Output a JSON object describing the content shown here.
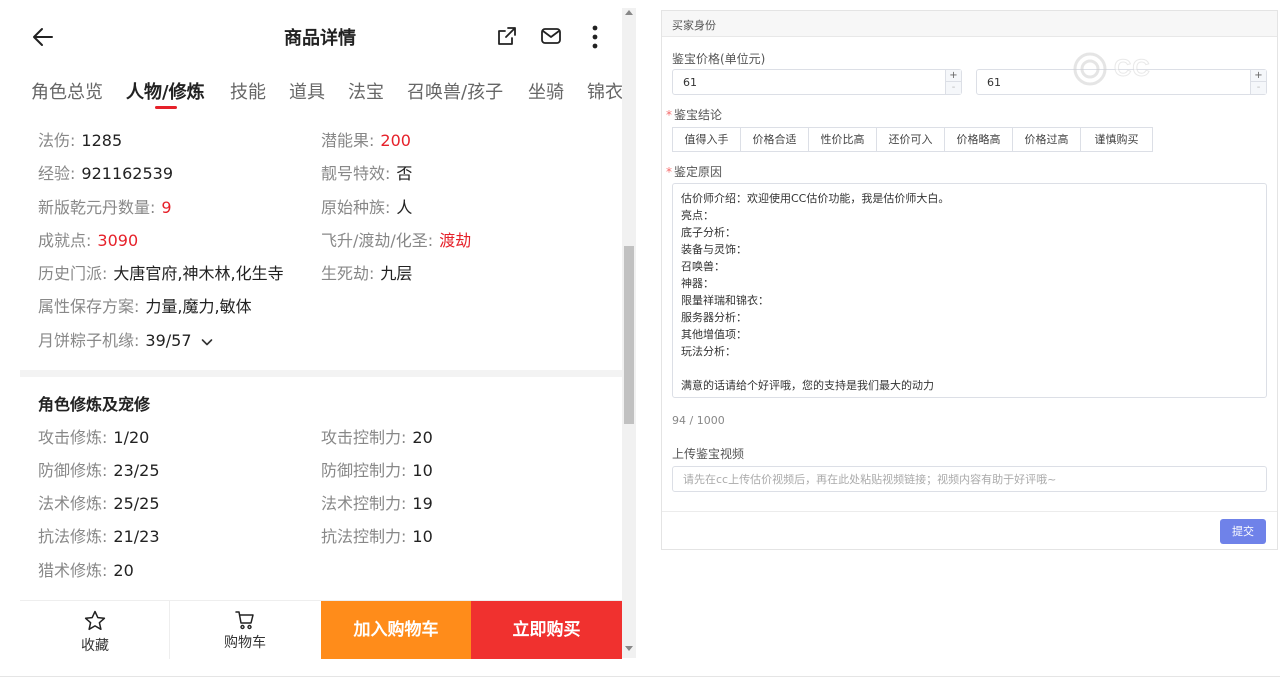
{
  "header": {
    "title": "商品详情"
  },
  "tabs": [
    {
      "label": "角色总览"
    },
    {
      "label": "人物/修炼"
    },
    {
      "label": "技能"
    },
    {
      "label": "道具"
    },
    {
      "label": "法宝"
    },
    {
      "label": "召唤兽/孩子"
    },
    {
      "label": "坐骑"
    },
    {
      "label": "锦衣"
    }
  ],
  "attributes": {
    "fashang": {
      "label": "法伤:",
      "value": "1285"
    },
    "qiannengguo": {
      "label": "潜能果:",
      "value": "200"
    },
    "jingyan": {
      "label": "经验:",
      "value": "921162539"
    },
    "lianghao": {
      "label": "靓号特效:",
      "value": "否"
    },
    "qianyuandan": {
      "label": "新版乾元丹数量:",
      "value": "9"
    },
    "zhongzu": {
      "label": "原始种族:",
      "value": "人"
    },
    "chengjiu": {
      "label": "成就点:",
      "value": "3090"
    },
    "feisheng": {
      "label": "飞升/渡劫/化圣:",
      "value": "渡劫"
    },
    "menpai": {
      "label": "历史门派:",
      "value": "大唐官府,神木林,化生寺"
    },
    "shengsijie": {
      "label": "生死劫:",
      "value": "九层"
    },
    "shuxing": {
      "label": "属性保存方案:",
      "value": "力量,魔力,敏体"
    },
    "jiyuan": {
      "label": "月饼粽子机缘:",
      "value": "39/57"
    }
  },
  "cultivation": {
    "title": "角色修炼及宠修",
    "gongji": {
      "label": "攻击修炼:",
      "value": "1/20"
    },
    "gongjikongzhi": {
      "label": "攻击控制力:",
      "value": "20"
    },
    "fangyu": {
      "label": "防御修炼:",
      "value": "23/25"
    },
    "fangyukongzhi": {
      "label": "防御控制力:",
      "value": "10"
    },
    "fashu": {
      "label": "法术修炼:",
      "value": "25/25"
    },
    "fashukongzhi": {
      "label": "法术控制力:",
      "value": "19"
    },
    "kangfa": {
      "label": "抗法修炼:",
      "value": "21/23"
    },
    "kangfakongzhi": {
      "label": "抗法控制力:",
      "value": "10"
    },
    "lieshu": {
      "label": "猎术修炼:",
      "value": "20"
    }
  },
  "bottom_bar": {
    "favorite": "收藏",
    "cart": "购物车",
    "add_to_cart": "加入购物车",
    "buy_now": "立即购买"
  },
  "form": {
    "card_title": "买家身份",
    "price_label": "鉴宝价格(单位元)",
    "price_min": "61",
    "price_max": "61",
    "stepper_plus": "+",
    "stepper_minus": "-",
    "watermark": "CC",
    "conclusion_label": "鉴宝结论",
    "required_mark": "*",
    "conclusions": [
      "值得入手",
      "价格合适",
      "性价比高",
      "还价可入",
      "价格略高",
      "价格过高",
      "谨慎购买"
    ],
    "reason_label": "鉴定原因",
    "reason_lines": [
      "估价师介绍：欢迎使用CC估价功能，我是估价师大白。",
      "亮点：",
      "底子分析：",
      "装备与灵饰：",
      "召唤兽：",
      "神器：",
      "限量祥瑞和锦衣：",
      "服务器分析：",
      "其他增值项：",
      "玩法分析：",
      "",
      "满意的话请给个好评哦，您的支持是我们最大的动力"
    ],
    "counter": "94 / 1000",
    "video_label": "上传鉴宝视频",
    "video_placeholder": "请先在cc上传估价视频后，再在此处粘贴视频链接；视频内容有助于好评哦~",
    "submit": "提交"
  },
  "colors": {
    "accent_red": "#e6212a",
    "cart_orange": "#ff8c1a",
    "buy_red": "#f0312f",
    "submit_blue": "#6f82e9"
  }
}
